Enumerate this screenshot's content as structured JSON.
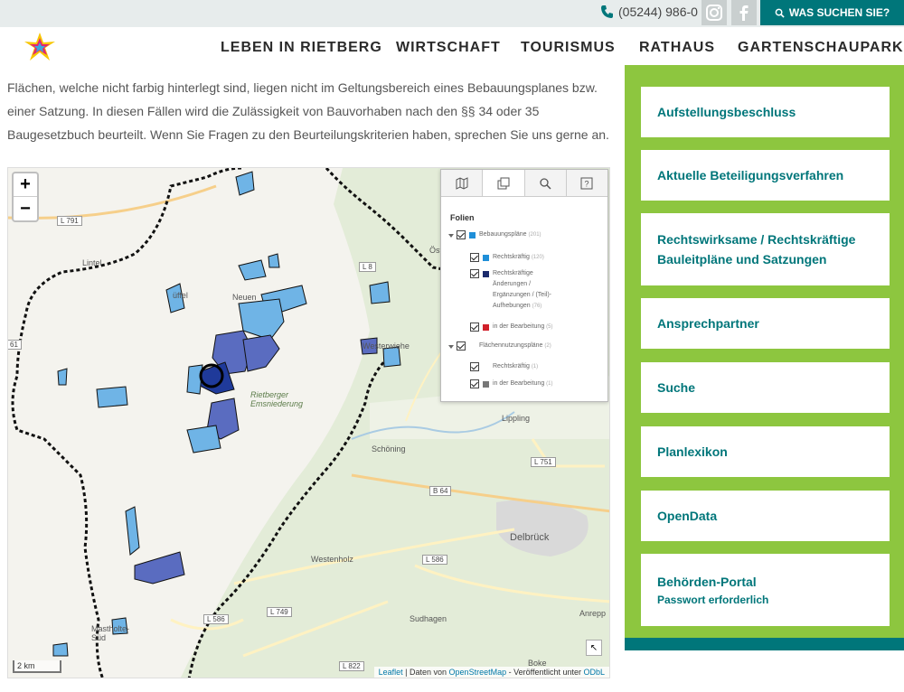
{
  "topbar": {
    "phone": "(05244) 986-0",
    "search_label": "WAS SUCHEN SIE?",
    "accent_color": "#00767a"
  },
  "nav": {
    "items": [
      "LEBEN IN RIETBERG",
      "WIRTSCHAFT",
      "TOURISMUS",
      "RATHAUS",
      "GARTENSCHAUPARK"
    ]
  },
  "intro": {
    "text": "Flächen, welche nicht farbig hinterlegt sind, liegen nicht im Geltungsbereich eines Bebauungsplanes bzw. einer Satzung. In diesen Fällen wird die Zulässigkeit von Bauvorhaben nach den §§ 34 oder 35 Baugesetzbuch beurteilt. Wenn Sie Fragen zu den Beurteilungskriterien haben, sprechen Sie uns gerne an."
  },
  "map": {
    "zoom_in": "+",
    "zoom_out": "−",
    "places": [
      "Lintel",
      "Neuen",
      "Rietberger Emsniederung",
      "Schöning",
      "Lippling",
      "Delbrück",
      "Westenholz",
      "Sudhagen",
      "Mastholte-Süd",
      "Boke",
      "Anrepp",
      "Öst",
      "Westerwiehe",
      "üffel"
    ],
    "roads": [
      "L 791",
      "L 751",
      "B 64",
      "L 586",
      "L 586",
      "L 749",
      "L 822",
      "61",
      "L 8"
    ],
    "scale": "2 km",
    "attribution": {
      "leaflet": "Leaflet",
      "sep1": " | Daten von ",
      "osm": "OpenStreetMap",
      "sep2": " - Veröffentlicht unter ",
      "odbl": "ODbL"
    },
    "layer_panel": {
      "title": "Folien",
      "rows": [
        {
          "label": "Bebauungspläne",
          "count": "(201)",
          "color": "#1f8fd8"
        },
        {
          "label": "Rechtskräftig",
          "count": "(120)",
          "color": "#1f8fd8"
        },
        {
          "label": "Rechtskräftige Änderungen / Ergänzungen / (Teil)-Aufhebungen",
          "count": "(76)",
          "color": "#1a2a6c"
        },
        {
          "label": "in der Bearbeitung",
          "count": "(5)",
          "color": "#d0202a"
        },
        {
          "label": "Flächennutzungspläne",
          "count": "(2)",
          "color": "#ffffff"
        },
        {
          "label": "Rechtskräftig",
          "count": "(1)",
          "color": "#ffffff"
        },
        {
          "label": "in der Bearbeitung",
          "count": "(1)",
          "color": "#777777"
        }
      ]
    }
  },
  "sidebar": {
    "items": [
      {
        "label": "Aufstellungsbeschluss"
      },
      {
        "label": "Aktuelle Beteiligungsverfahren"
      },
      {
        "label": "Rechtswirksame / Rechtskräftige Bauleitpläne und Satzungen"
      },
      {
        "label": "Ansprechpartner"
      },
      {
        "label": "Suche"
      },
      {
        "label": "Planlexikon"
      },
      {
        "label": "OpenData"
      },
      {
        "label": "Behörden-Portal",
        "sub": "Passwort erforderlich"
      }
    ],
    "color": "#8dc63f"
  }
}
